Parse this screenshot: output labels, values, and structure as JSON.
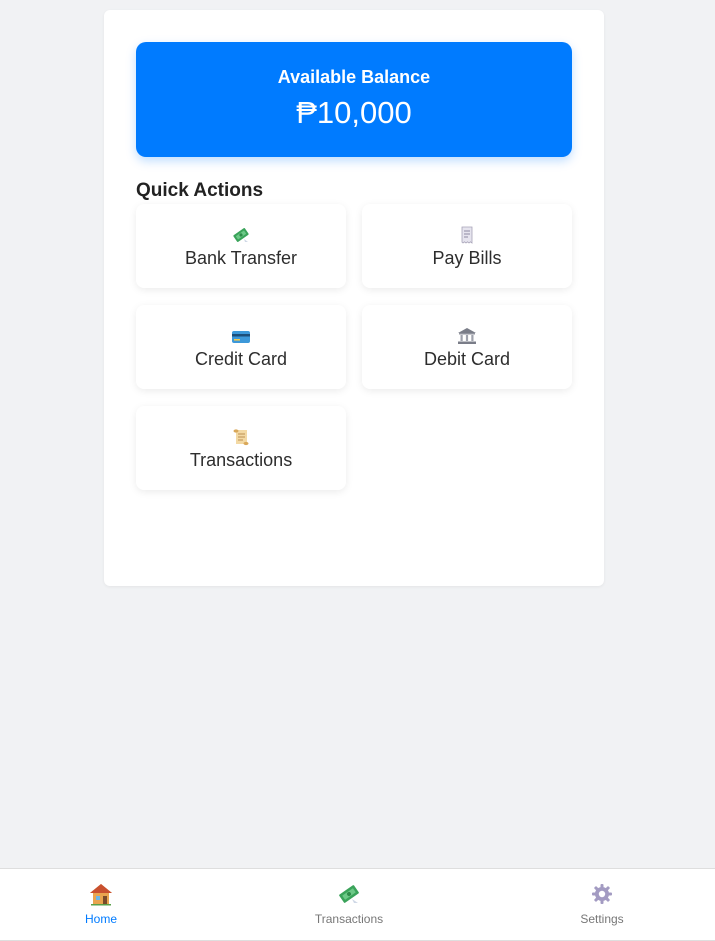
{
  "balance": {
    "label": "Available Balance",
    "amount": "₱10,000"
  },
  "quick_actions": {
    "title": "Quick Actions",
    "items": [
      {
        "label": "Bank Transfer",
        "icon": "money-wings-icon"
      },
      {
        "label": "Pay Bills",
        "icon": "receipt-icon"
      },
      {
        "label": "Credit Card",
        "icon": "credit-card-icon"
      },
      {
        "label": "Debit Card",
        "icon": "bank-icon"
      },
      {
        "label": "Transactions",
        "icon": "scroll-icon"
      }
    ]
  },
  "bottom_nav": {
    "items": [
      {
        "label": "Home",
        "icon": "house-icon",
        "active": true
      },
      {
        "label": "Transactions",
        "icon": "money-wings-icon",
        "active": false
      },
      {
        "label": "Settings",
        "icon": "gear-icon",
        "active": false
      }
    ]
  },
  "colors": {
    "accent": "#007bff",
    "background": "#f1f2f4",
    "card": "#ffffff"
  }
}
